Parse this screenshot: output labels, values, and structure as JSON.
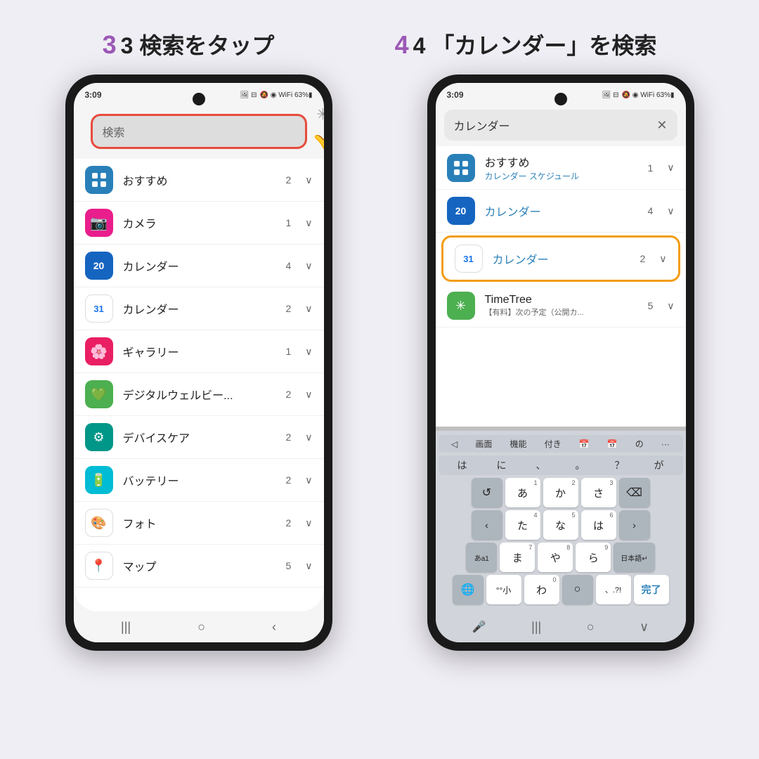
{
  "background": "#f0eef5",
  "step3": {
    "label": "3 検索をタップ"
  },
  "step4": {
    "label": "4 「カレンダー」を検索"
  },
  "phone1": {
    "status_time": "3:09",
    "status_battery": "63%",
    "search_placeholder": "検索",
    "apps": [
      {
        "name": "おすすめ",
        "count": "2",
        "icon_type": "grid"
      },
      {
        "name": "カメラ",
        "count": "1",
        "icon_type": "camera"
      },
      {
        "name": "カレンダー",
        "count": "4",
        "icon_type": "cal-blue"
      },
      {
        "name": "カレンダー",
        "count": "2",
        "icon_type": "cal-google"
      },
      {
        "name": "ギャラリー",
        "count": "1",
        "icon_type": "gallery"
      },
      {
        "name": "デジタルウェルビー...",
        "count": "2",
        "icon_type": "wellbeing"
      },
      {
        "name": "デバイスケア",
        "count": "2",
        "icon_type": "devicecare"
      },
      {
        "name": "バッテリー",
        "count": "2",
        "icon_type": "battery"
      },
      {
        "name": "フォト",
        "count": "2",
        "icon_type": "photos"
      },
      {
        "name": "マップ",
        "count": "5",
        "icon_type": "maps"
      }
    ],
    "nav": [
      "|||",
      "○",
      "<"
    ]
  },
  "phone2": {
    "status_time": "3:09",
    "status_battery": "63%",
    "search_text": "カレンダー",
    "results": [
      {
        "name": "おすすめ",
        "sub": "カレンダー スケジュール",
        "count": "1",
        "icon_type": "grid",
        "highlight": false
      },
      {
        "name": "カレンダー",
        "sub": "",
        "count": "4",
        "icon_type": "cal-blue",
        "highlight": false
      },
      {
        "name": "カレンダー",
        "sub": "",
        "count": "2",
        "icon_type": "cal-google31",
        "highlight": true
      },
      {
        "name": "TimeTree",
        "sub": "【有料】次の予定（公開カ...",
        "count": "5",
        "icon_type": "timetree",
        "highlight": false
      }
    ],
    "keyboard": {
      "top_row": [
        "◁",
        "画面",
        "機能",
        "付き",
        "📅",
        "📅",
        "の",
        "..."
      ],
      "row1": [
        "は",
        "に",
        "、",
        "。",
        "？",
        "が"
      ],
      "row2_label": [
        "あ",
        "か",
        "さ",
        "⌫"
      ],
      "row3_label": [
        "<",
        "た",
        "な",
        "は",
        ">"
      ],
      "row4_label": [
        "あa1",
        "ま",
        "や",
        "ら",
        "日本語↵"
      ],
      "row5_label": [
        "🌐",
        "°°小",
        "わ",
        "○",
        "、.?!",
        "完了"
      ]
    },
    "nav": [
      "|||",
      "○",
      "∨"
    ]
  }
}
